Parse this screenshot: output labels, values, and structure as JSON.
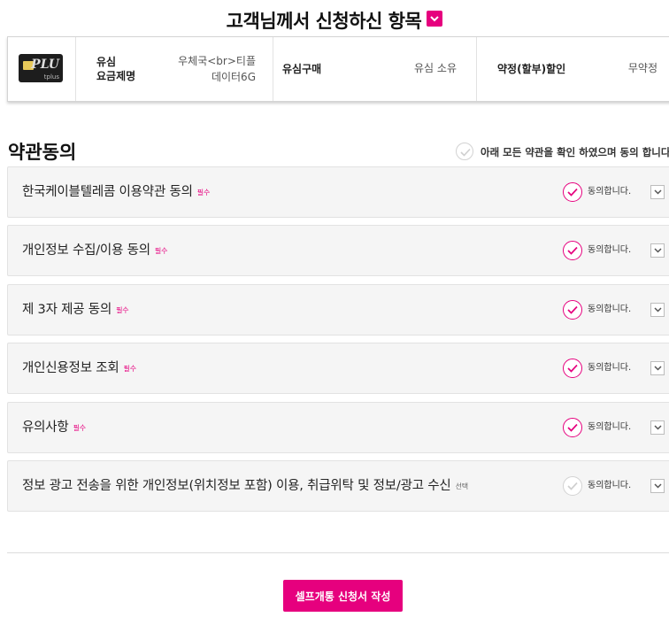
{
  "page": {
    "title": "고객님께서 신청하신 항목",
    "toggle_icon": "chevron-down-icon",
    "accent_color": "#e6007e"
  },
  "summary": {
    "sim_image_text": "PLU",
    "sim_image_logo": "tplus",
    "sim_label": "유심",
    "plan_label": "요금제명",
    "plan_value_line1": "우체국<br>티플",
    "plan_value_line2": "데이터6G",
    "purchase_label": "유심구매",
    "purchase_value": "유심 소유",
    "discount_label": "약정(할부)할인",
    "discount_value": "무약정"
  },
  "terms": {
    "section_title": "약관동의",
    "agree_all_label": "아래 모든 약관을 확인 하였으며 동의 합니다",
    "agree_label": "동의합니다.",
    "items": [
      {
        "title": "한국케이블텔레콤 이용약관 동의",
        "tag": "필수",
        "checked": true
      },
      {
        "title": "개인정보 수집/이용 동의",
        "tag": "필수",
        "checked": true
      },
      {
        "title": "제 3자 제공 동의",
        "tag": "필수",
        "checked": true
      },
      {
        "title": "개인신용정보 조회",
        "tag": "필수",
        "checked": true
      },
      {
        "title": "유의사항",
        "tag": "필수",
        "checked": true
      },
      {
        "title": "정보 광고 전송을 위한 개인정보(위치정보 포함) 이용, 취급위탁 및 정보/광고 수신",
        "tag": "선택",
        "checked": false
      }
    ]
  },
  "footer": {
    "submit_label": "셀프개통 신청서 작성"
  }
}
